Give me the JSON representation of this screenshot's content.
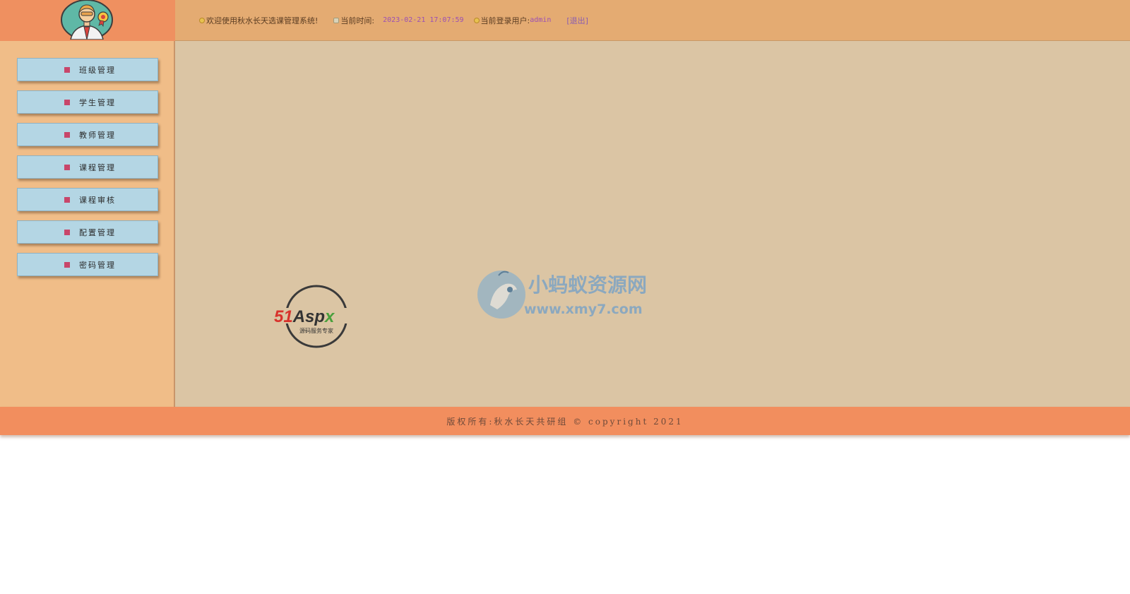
{
  "header": {
    "welcome": "欢迎使用秋水长天选课管理系统!",
    "time_label": "当前时间:",
    "time_value": "2023-02-21 17:07:59",
    "user_label": "当前登录用户:",
    "user_value": "admin",
    "logout": "[退出]"
  },
  "sidebar": {
    "items": [
      {
        "label": "班级管理"
      },
      {
        "label": "学生管理"
      },
      {
        "label": "教师管理"
      },
      {
        "label": "课程管理"
      },
      {
        "label": "课程审核"
      },
      {
        "label": "配置管理"
      },
      {
        "label": "密码管理"
      }
    ]
  },
  "watermarks": {
    "logo1_brand_a": "51",
    "logo1_brand_b": "Asp",
    "logo1_brand_c": "x",
    "logo1_tagline": "源码服务专家",
    "logo2_title": "小蚂蚁资源网",
    "logo2_url": "www.xmy7.com"
  },
  "footer": {
    "copyright": "版权所有:秋水长天共研组 © copyright 2021"
  },
  "colors": {
    "header_left": "#ef9060",
    "header_bar": "#e4ab72",
    "sidebar_bg": "#f0bd88",
    "main_bg": "#dbc5a4",
    "menu_button": "#b4d6e4",
    "menu_bullet": "#c8466a",
    "footer_bg": "#f28e5e"
  }
}
